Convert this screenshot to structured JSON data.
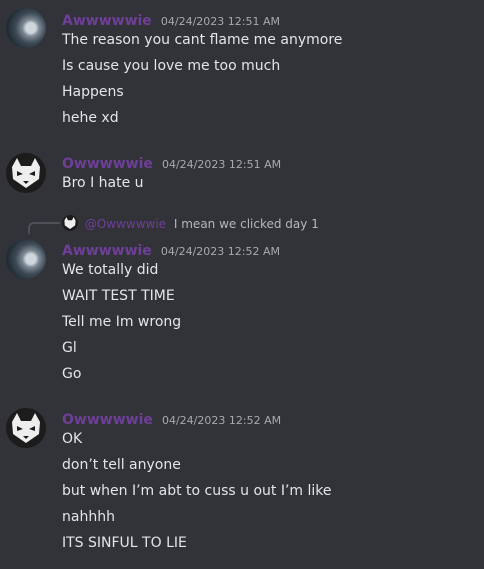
{
  "messages": [
    {
      "author": "Awwwwwie",
      "timestamp": "04/24/2023 12:51 AM",
      "lines": [
        "The reason you cant flame me anymore",
        "Is cause you love me too much",
        "Happens",
        "hehe xd"
      ]
    },
    {
      "author": "Owwwwwie",
      "timestamp": "04/24/2023 12:51 AM",
      "lines": [
        "Bro I hate u"
      ]
    },
    {
      "reply": {
        "mention": "@Owwwwwie",
        "text": "I mean we clicked day 1"
      },
      "author": "Awwwwwie",
      "timestamp": "04/24/2023 12:52 AM",
      "lines": [
        "We totally did",
        "WAIT TEST TIME",
        "Tell me Im wrong",
        "Gl",
        "Go"
      ]
    },
    {
      "author": "Owwwwwie",
      "timestamp": "04/24/2023 12:52 AM",
      "lines": [
        "OK",
        "don’t tell anyone",
        "but when I’m abt to cuss u out I’m like",
        "nahhhh",
        "ITS SINFUL TO LIE"
      ]
    }
  ],
  "colors": {
    "background": "#313338",
    "username": "#6f3f97",
    "text": "#e4e5e8",
    "timestamp": "#a7a9ae"
  }
}
